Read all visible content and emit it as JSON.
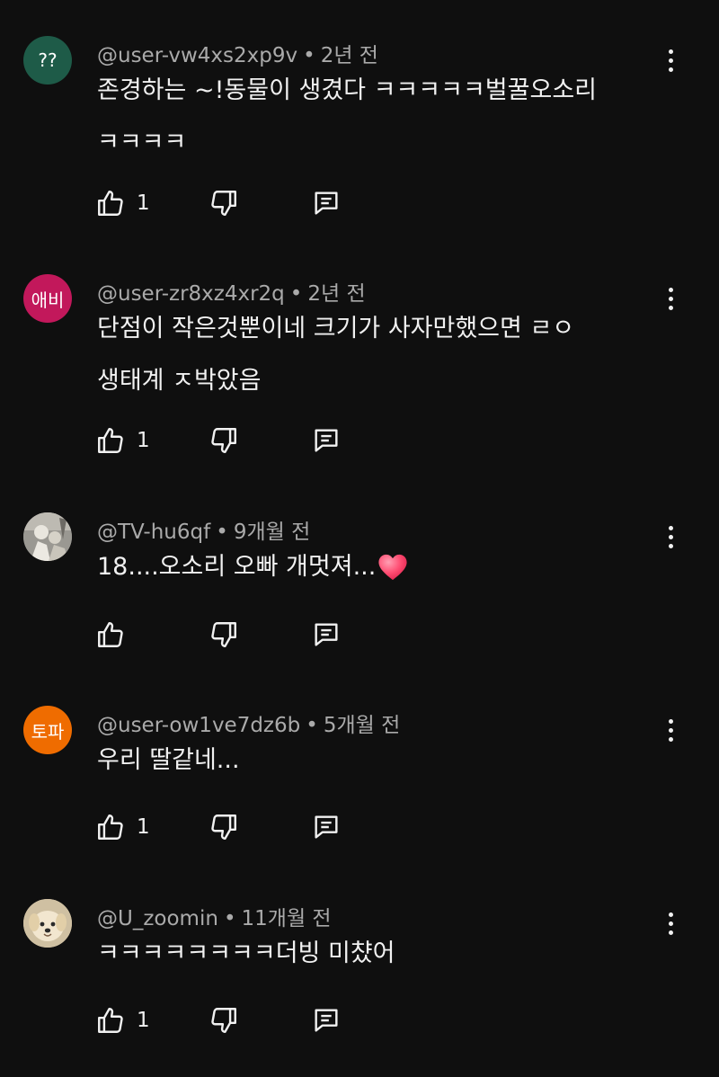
{
  "comments": [
    {
      "avatar_text": "??",
      "avatar_color": "#1e5b48",
      "username": "@user-vw4xs2xp9v",
      "time": "2년 전",
      "line1": "존경하는 ~!동물이 생겼다  ㅋㅋㅋㅋㅋ벌꿀오소리",
      "line2": "ㅋㅋㅋㅋ",
      "likes": "1"
    },
    {
      "avatar_text": "애비",
      "avatar_color": "#c2185b",
      "username": "@user-zr8xz4xr2q",
      "time": "2년 전",
      "line1": "단점이 작은것뿐이네 크기가 사자만했으면 ㄹㅇ",
      "line2": "생태계 ㅈ박았음",
      "likes": "1"
    },
    {
      "avatar_text": "",
      "avatar_color": "#8a8a86",
      "username": "@TV-hu6qf",
      "time": "9개월 전",
      "line1": "18....오소리 오빠 개멋져...",
      "line2": "",
      "likes": ""
    },
    {
      "avatar_text": "토파",
      "avatar_color": "#ef6c00",
      "username": "@user-ow1ve7dz6b",
      "time": "5개월 전",
      "line1": "우리 딸같네...",
      "line2": "",
      "likes": "1"
    },
    {
      "avatar_text": "",
      "avatar_color": "#d8c7a8",
      "username": "@U_zoomin",
      "time": "11개월 전",
      "line1": "ㅋㅋㅋㅋㅋㅋㅋㅋ더빙 미챴어",
      "line2": "",
      "likes": "1"
    }
  ],
  "icons": {
    "like": "thumbs-up-icon",
    "dislike": "thumbs-down-icon",
    "reply": "reply-icon",
    "more": "more-vert-icon",
    "heart": "heart-icon"
  }
}
